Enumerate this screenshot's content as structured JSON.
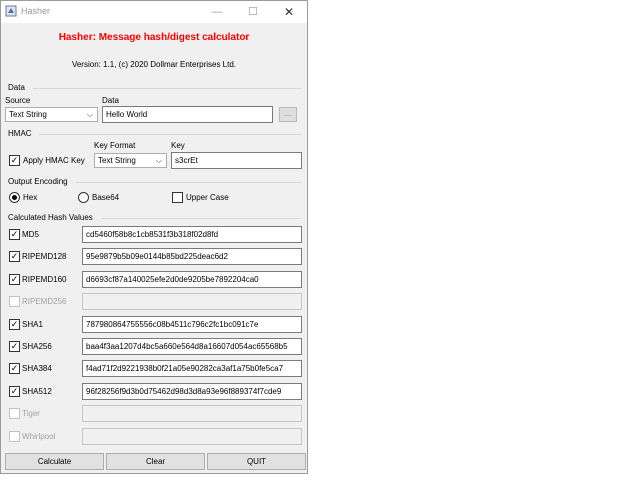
{
  "window": {
    "title": "Hasher",
    "minimize_glyph": "—",
    "maximize_glyph": "☐",
    "close_glyph": "✕"
  },
  "header": {
    "heading": "Hasher: Message hash/digest calculator",
    "version": "Version: 1.1, (c) 2020 Dollmar Enterprises Ltd."
  },
  "data_group": {
    "label": "Data",
    "source_label": "Source",
    "source_value": "Text String",
    "data_label": "Data",
    "data_value": "Hello World",
    "browse_label": "..."
  },
  "hmac_group": {
    "label": "HMAC",
    "apply_label": "Apply HMAC Key",
    "apply_checked": true,
    "key_format_label": "Key Format",
    "key_format_value": "Text String",
    "key_label": "Key",
    "key_value": "s3crEt"
  },
  "encoding_group": {
    "label": "Output Encoding",
    "hex_label": "Hex",
    "base64_label": "Base64",
    "selected": "Hex",
    "upper_case_label": "Upper Case",
    "upper_case_checked": false
  },
  "hash_group": {
    "label": "Calculated Hash Values",
    "rows": [
      {
        "name": "MD5",
        "checked": true,
        "enabled": true,
        "value": "cd5460f58b8c1cb8531f3b318f02d8fd"
      },
      {
        "name": "RIPEMD128",
        "checked": true,
        "enabled": true,
        "value": "95e9879b5b09e0144b85bd225deac6d2"
      },
      {
        "name": "RIPEMD160",
        "checked": true,
        "enabled": true,
        "value": "d6693cf87a140025efe2d0de9205be7892204ca0"
      },
      {
        "name": "RIPEMD256",
        "checked": false,
        "enabled": false,
        "value": ""
      },
      {
        "name": "SHA1",
        "checked": true,
        "enabled": true,
        "value": "787980864755556c08b4511c796c2fc1bc091c7e"
      },
      {
        "name": "SHA256",
        "checked": true,
        "enabled": true,
        "value": "baa4f3aa1207d4bc5a660e564d8a16607d054ac65568b5"
      },
      {
        "name": "SHA384",
        "checked": true,
        "enabled": true,
        "value": "f4ad71f2d9221938b0f21a05e90282ca3af1a75b0fe5ca7"
      },
      {
        "name": "SHA512",
        "checked": true,
        "enabled": true,
        "value": "96f28256f9d3b0d75462d98d3d8a93e96f889374f7cde9"
      },
      {
        "name": "Tiger",
        "checked": false,
        "enabled": false,
        "value": ""
      },
      {
        "name": "Whirlpool",
        "checked": false,
        "enabled": false,
        "value": ""
      }
    ]
  },
  "buttons": {
    "calculate": "Calculate",
    "clear": "Clear",
    "quit": "QUIT"
  },
  "check_glyph": "✓",
  "colors": {
    "heading": "#ff0000",
    "window_bg": "#f0f0f0"
  }
}
